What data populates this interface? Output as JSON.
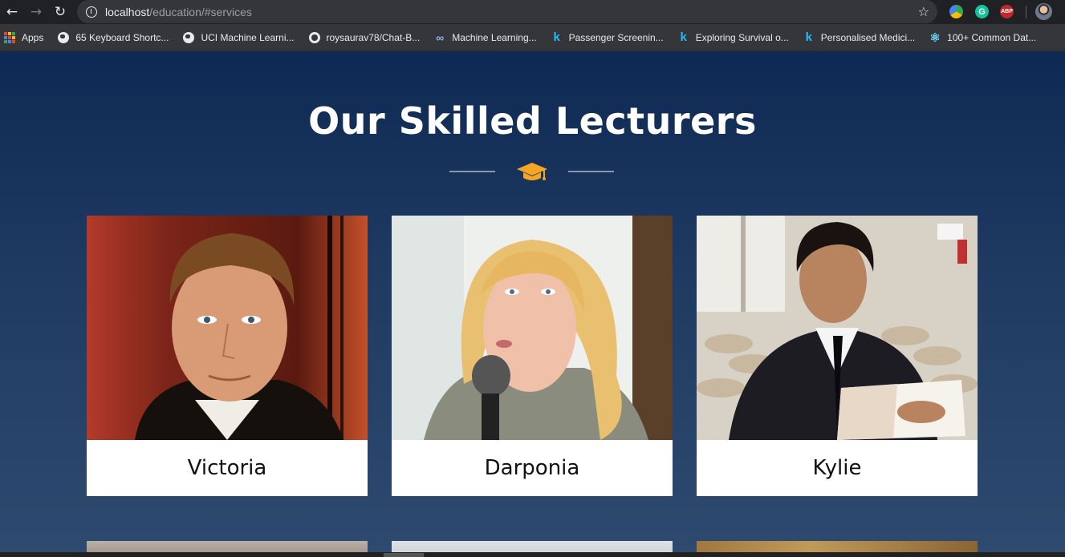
{
  "browser": {
    "url_host": "localhost",
    "url_path": "/education/#services",
    "bookmarks": [
      {
        "label": "Apps",
        "icon": "apps-grid-icon"
      },
      {
        "label": "65 Keyboard Shortc...",
        "icon": "globe-icon"
      },
      {
        "label": "UCI Machine Learni...",
        "icon": "globe-icon"
      },
      {
        "label": "roysaurav78/Chat-B...",
        "icon": "github-icon"
      },
      {
        "label": "Machine Learning...",
        "icon": "link-icon"
      },
      {
        "label": "Passenger Screenin...",
        "icon": "kaggle-icon"
      },
      {
        "label": "Exploring Survival o...",
        "icon": "kaggle-icon"
      },
      {
        "label": "Personalised Medici...",
        "icon": "kaggle-icon"
      },
      {
        "label": "100+ Common Dat...",
        "icon": "react-atom-icon"
      }
    ],
    "extensions": [
      "G",
      "ABP"
    ]
  },
  "section": {
    "title": "Our Skilled Lecturers",
    "icon": "graduation-cap-icon",
    "accent_color": "#f5a623"
  },
  "lecturers": [
    {
      "name": "Victoria"
    },
    {
      "name": "Darponia"
    },
    {
      "name": "Kylie"
    }
  ]
}
